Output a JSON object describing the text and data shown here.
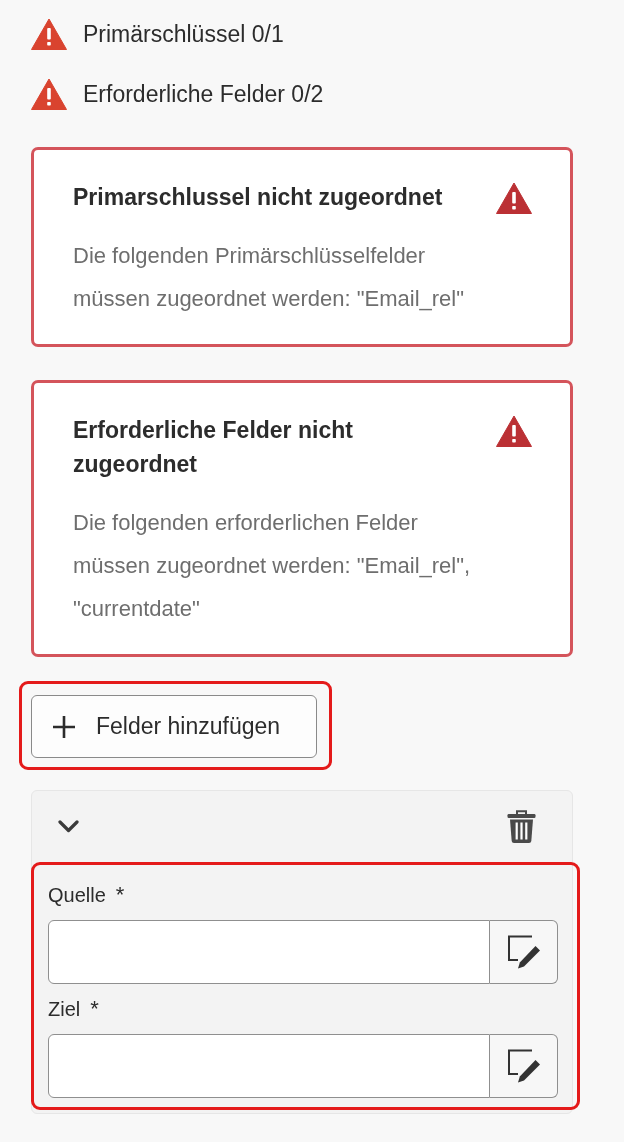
{
  "status_items": [
    {
      "label": "Primärschlüssel 0/1"
    },
    {
      "label": "Erforderliche Felder 0/2"
    }
  ],
  "alerts": [
    {
      "title": "Primarschlussel nicht zugeordnet",
      "message": "Die folgenden Primärschlüsselfelder müssen zugeordnet werden: \"Email_rel\""
    },
    {
      "title": "Erforderliche Felder nicht zugeordnet",
      "message": "Die folgenden erforderlichen Felder müssen zugeordnet werden: \"Email_rel\", \"currentdate\""
    }
  ],
  "add_button": {
    "label": "Felder hinzufügen",
    "highlighted": true
  },
  "mapping": {
    "expanded": true,
    "fields_highlighted": true,
    "fields": [
      {
        "label": "Quelle",
        "required_mark": "*"
      },
      {
        "label": "Ziel",
        "required_mark": "*"
      }
    ]
  }
}
